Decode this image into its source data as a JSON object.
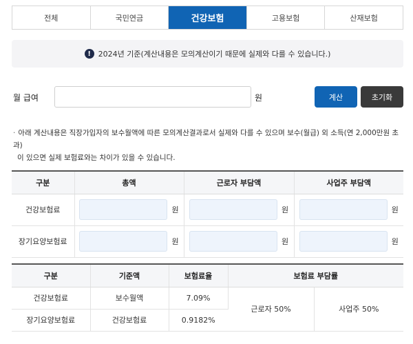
{
  "tabs": [
    {
      "label": "전체",
      "active": false
    },
    {
      "label": "국민연금",
      "active": false
    },
    {
      "label": "건강보험",
      "active": true
    },
    {
      "label": "고용보험",
      "active": false
    },
    {
      "label": "산재보험",
      "active": false
    }
  ],
  "notice": {
    "icon": "exclamation-circle-icon",
    "text": "2024년 기준(계산내용은 모의계산이기 때문에 실제와 다를 수 있습니다.)"
  },
  "wage": {
    "label": "월 급여",
    "value": "",
    "unit": "원"
  },
  "buttons": {
    "calc": "계산",
    "reset": "초기화"
  },
  "description": {
    "line1": "아래 계산내용은 직장가입자의 보수월액에 따른 모의계산결과로서 실제와 다를 수 있으며 보수(월급) 외 소득(연 2,000만원 초과)",
    "line2": "이 있으면 실제 보험료와는 차이가 있을 수 있습니다."
  },
  "result_table": {
    "headers": [
      "구분",
      "총액",
      "근로자 부담액",
      "사업주 부담액"
    ],
    "unit": "원",
    "rows": [
      {
        "label": "건강보험료",
        "total": "",
        "employee": "",
        "employer": ""
      },
      {
        "label": "장기요양보험료",
        "total": "",
        "employee": "",
        "employer": ""
      }
    ]
  },
  "rate_table": {
    "headers": [
      "구분",
      "기준액",
      "보험료율",
      "보험료 부담률"
    ],
    "rows": [
      {
        "label": "건강보험료",
        "base": "보수월액",
        "rate": "7.09%"
      },
      {
        "label": "장기요양보험료",
        "base": "건강보험료",
        "rate": "0.9182%"
      }
    ],
    "share": {
      "employee": "근로자 50%",
      "employer": "사업주 50%"
    }
  }
}
